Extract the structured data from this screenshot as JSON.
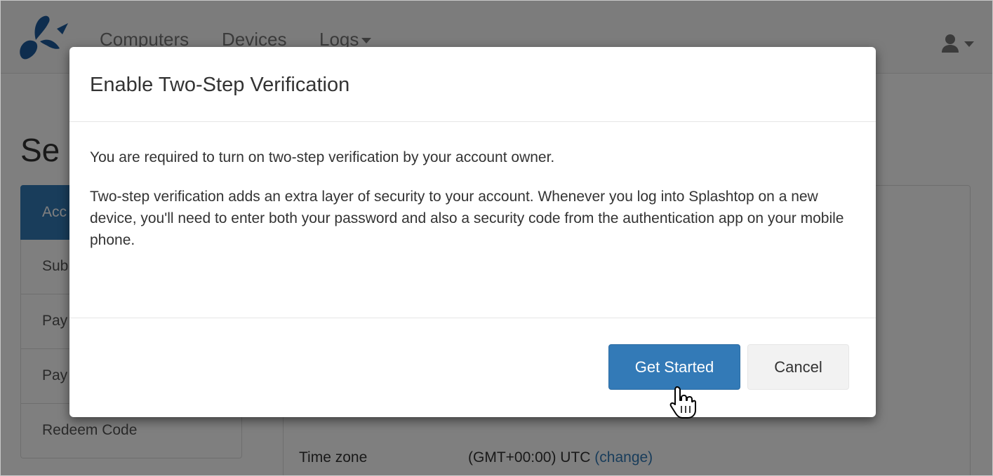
{
  "navbar": {
    "items": [
      "Computers",
      "Devices",
      "Logs"
    ]
  },
  "page": {
    "title": "Se",
    "side_nav": [
      "Acc",
      "Sub",
      "Pay",
      "Pay",
      "Redeem Code"
    ],
    "timezone_label": "Time zone",
    "timezone_value": "(GMT+00:00) UTC",
    "timezone_link": "(change)"
  },
  "modal": {
    "title": "Enable Two-Step Verification",
    "paragraph_1": "You are required to turn on two-step verification by your account owner.",
    "paragraph_2": "Two-step verification adds an extra layer of security to your account. Whenever you log into Splashtop on a new device, you'll need to enter both your password and also a security code from the authentication app on your mobile phone.",
    "primary_button": "Get Started",
    "cancel_button": "Cancel"
  },
  "colors": {
    "brand": "#1d5b9c",
    "primary": "#337ab7",
    "backdrop": "rgba(0,0,0,0.5)"
  },
  "icons": {
    "logo": "splashtop-logo-icon",
    "user": "user-icon",
    "cursor": "hand-pointer-icon"
  }
}
